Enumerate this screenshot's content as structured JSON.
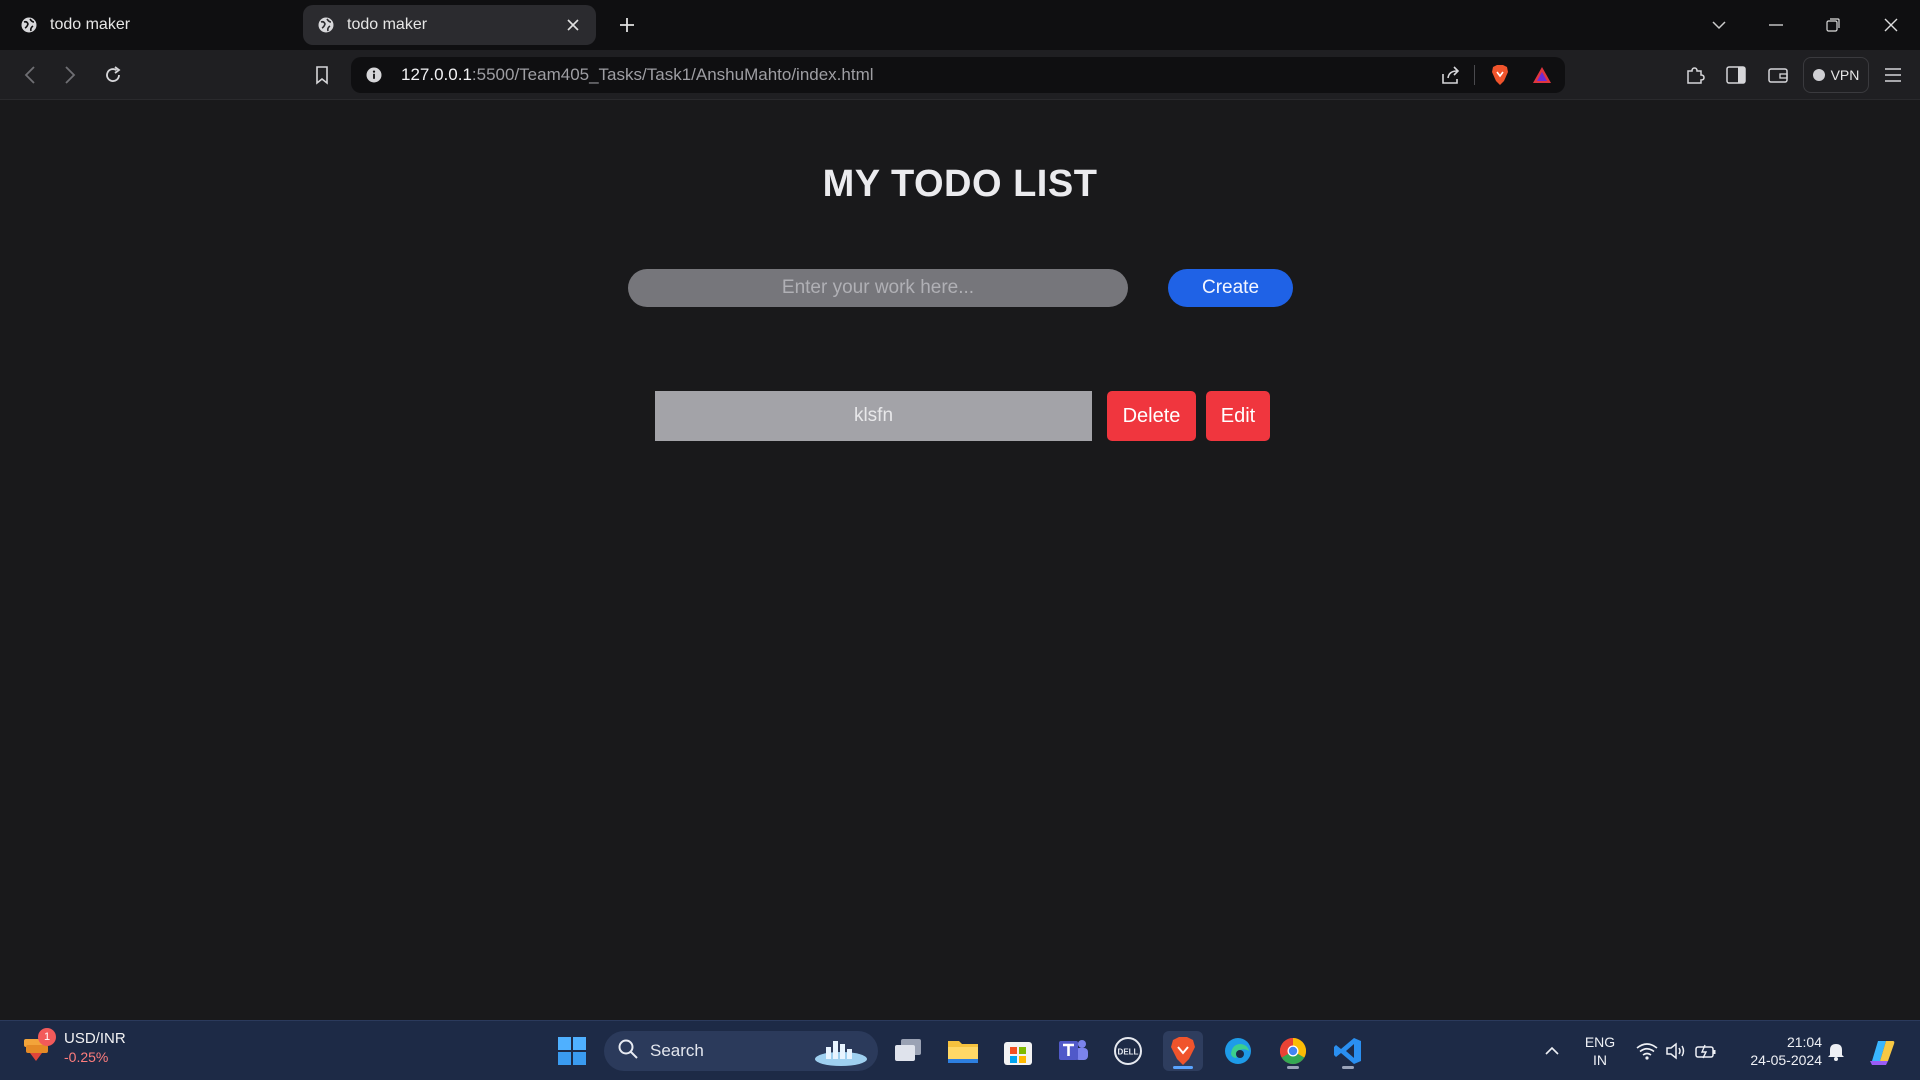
{
  "browser": {
    "tabs": [
      {
        "title": "todo maker",
        "active": false
      },
      {
        "title": "todo maker",
        "active": true
      }
    ],
    "url": {
      "host": "127.0.0.1",
      "path": ":5500/Team405_Tasks/Task1/AnshuMahto/index.html"
    },
    "vpn_label": "VPN"
  },
  "page": {
    "title": "MY TODO LIST",
    "input": {
      "placeholder": "Enter your work here...",
      "value": ""
    },
    "create_label": "Create",
    "todos": [
      {
        "text": "klsfn",
        "delete_label": "Delete",
        "edit_label": "Edit"
      }
    ]
  },
  "taskbar": {
    "widget": {
      "badge": "1",
      "ticker": "USD/INR",
      "change": "-0.25%"
    },
    "search_label": "Search",
    "language": {
      "line1": "ENG",
      "line2": "IN"
    },
    "clock": {
      "time": "21:04",
      "date": "24-05-2024"
    },
    "icons": [
      "windows-start-icon",
      "task-view-icon",
      "file-explorer-icon",
      "microsoft-store-icon",
      "teams-icon",
      "dell-icon",
      "brave-icon",
      "edge-icon",
      "chrome-icon",
      "vscode-icon"
    ]
  },
  "colors": {
    "page_bg": "#19191b",
    "create_button": "#1f62e6",
    "danger_button": "#f0363e",
    "taskbar_bg": "#1d2a46"
  }
}
